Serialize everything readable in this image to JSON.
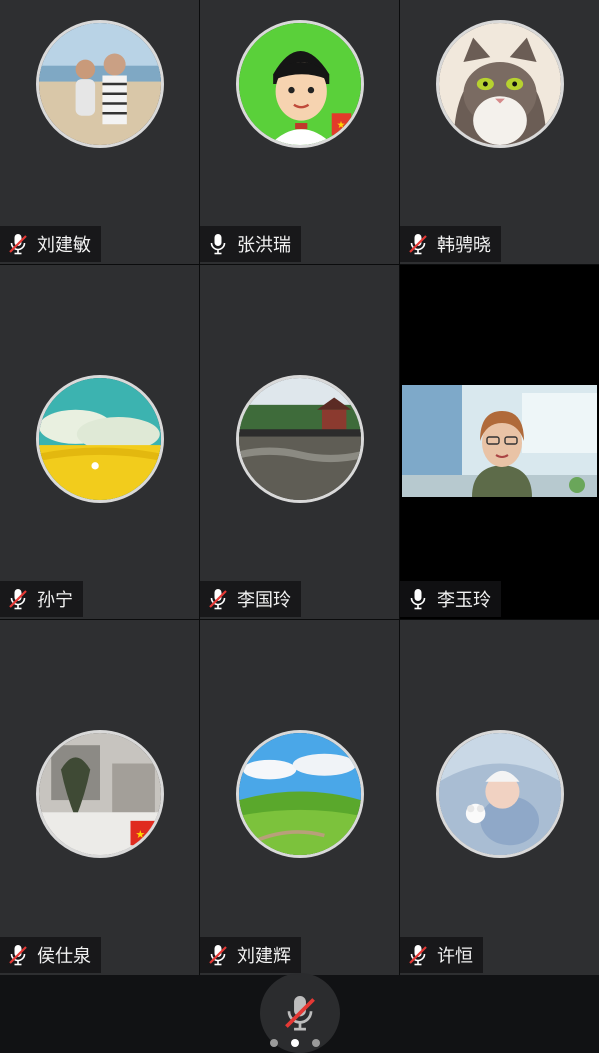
{
  "participants": [
    {
      "name": "刘建敏",
      "muted": true,
      "avatar": "beach-family-photo-avatar"
    },
    {
      "name": "张洪瑞",
      "muted": false,
      "avatar": "cartoon-boy-avatar"
    },
    {
      "name": "韩骋晓",
      "muted": true,
      "avatar": "cat-avatar"
    },
    {
      "name": "孙宁",
      "muted": true,
      "avatar": "wheat-field-avatar"
    },
    {
      "name": "李国玲",
      "muted": true,
      "avatar": "pavilion-river-avatar"
    },
    {
      "name": "李玉玲",
      "muted": false,
      "avatar": "live-video",
      "active_speaker": true
    },
    {
      "name": "侯仕泉",
      "muted": true,
      "avatar": "snow-street-avatar"
    },
    {
      "name": "刘建辉",
      "muted": true,
      "avatar": "green-hills-avatar"
    },
    {
      "name": "许恒",
      "muted": false,
      "avatar": "newborn-baby-avatar"
    }
  ],
  "controls": {
    "self_mic": "muted",
    "page_count": 3,
    "current_page": 2
  },
  "colors": {
    "active_border": "#3bbf5a",
    "muted_slash": "#e53935",
    "tile_bg": "#2e2f31"
  }
}
